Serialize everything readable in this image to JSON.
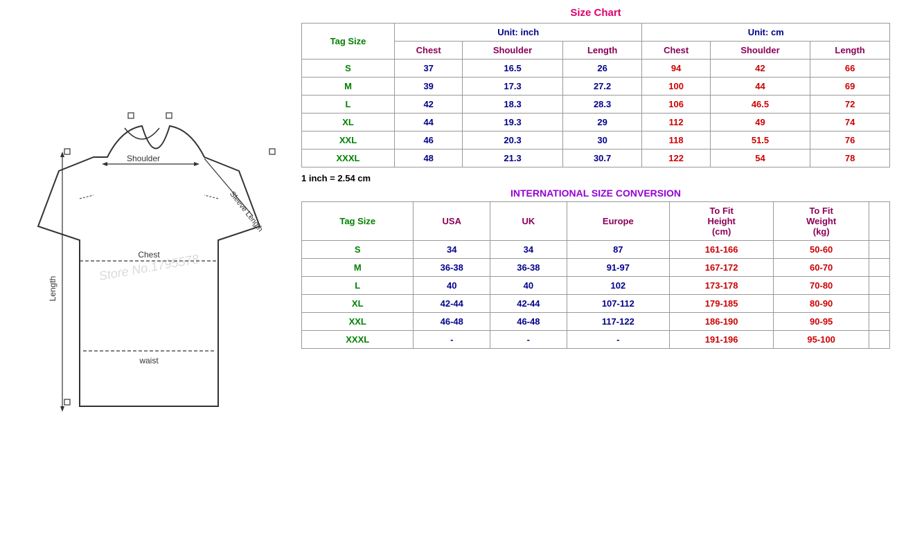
{
  "leftPanel": {
    "watermark": "Store No.1795578"
  },
  "sizeChart": {
    "title": "Size Chart",
    "unitInch": "Unit: inch",
    "unitCm": "Unit: cm",
    "tagSizeLabel": "Tag Size",
    "columns": [
      "Chest",
      "Shoulder",
      "Length",
      "Chest",
      "Shoulder",
      "Length"
    ],
    "rows": [
      {
        "tag": "S",
        "chestIn": "37",
        "shoulderIn": "16.5",
        "lengthIn": "26",
        "chestCm": "94",
        "shoulderCm": "42",
        "lengthCm": "66"
      },
      {
        "tag": "M",
        "chestIn": "39",
        "shoulderIn": "17.3",
        "lengthIn": "27.2",
        "chestCm": "100",
        "shoulderCm": "44",
        "lengthCm": "69"
      },
      {
        "tag": "L",
        "chestIn": "42",
        "shoulderIn": "18.3",
        "lengthIn": "28.3",
        "chestCm": "106",
        "shoulderCm": "46.5",
        "lengthCm": "72"
      },
      {
        "tag": "XL",
        "chestIn": "44",
        "shoulderIn": "19.3",
        "lengthIn": "29",
        "chestCm": "112",
        "shoulderCm": "49",
        "lengthCm": "74"
      },
      {
        "tag": "XXL",
        "chestIn": "46",
        "shoulderIn": "20.3",
        "lengthIn": "30",
        "chestCm": "118",
        "shoulderCm": "51.5",
        "lengthCm": "76"
      },
      {
        "tag": "XXXL",
        "chestIn": "48",
        "shoulderIn": "21.3",
        "lengthIn": "30.7",
        "chestCm": "122",
        "shoulderCm": "54",
        "lengthCm": "78"
      }
    ],
    "conversionNote": "1 inch = 2.54 cm"
  },
  "intlConversion": {
    "title": "INTERNATIONAL SIZE CONVERSION",
    "tagSizeLabel": "Tag Size",
    "columns": [
      "USA",
      "UK",
      "Europe",
      "To Fit Height (cm)",
      "To Fit Weight (kg)"
    ],
    "rows": [
      {
        "tag": "S",
        "usa": "34",
        "uk": "34",
        "europe": "87",
        "height": "161-166",
        "weight": "50-60"
      },
      {
        "tag": "M",
        "usa": "36-38",
        "uk": "36-38",
        "europe": "91-97",
        "height": "167-172",
        "weight": "60-70"
      },
      {
        "tag": "L",
        "usa": "40",
        "uk": "40",
        "europe": "102",
        "height": "173-178",
        "weight": "70-80"
      },
      {
        "tag": "XL",
        "usa": "42-44",
        "uk": "42-44",
        "europe": "107-112",
        "height": "179-185",
        "weight": "80-90"
      },
      {
        "tag": "XXL",
        "usa": "46-48",
        "uk": "46-48",
        "europe": "117-122",
        "height": "186-190",
        "weight": "90-95"
      },
      {
        "tag": "XXXL",
        "usa": "-",
        "uk": "-",
        "europe": "-",
        "height": "191-196",
        "weight": "95-100"
      }
    ]
  }
}
